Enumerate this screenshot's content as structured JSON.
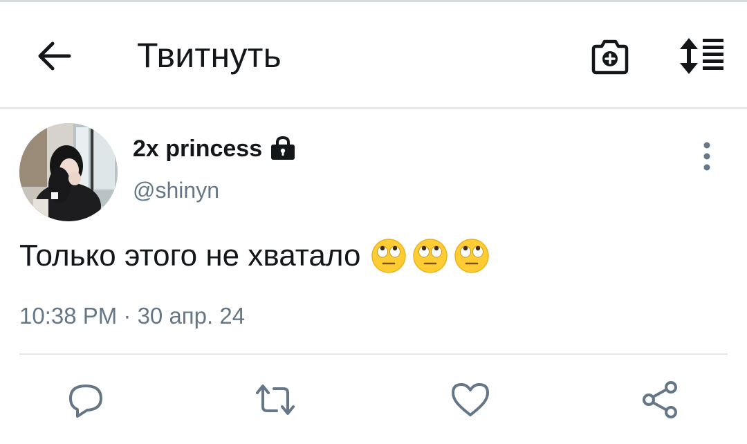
{
  "header": {
    "title": "Твитнуть",
    "back_icon": "arrow-left-icon",
    "camera_icon": "camera-plus-icon",
    "sort_icon": "sort-list-icon"
  },
  "tweet": {
    "author": {
      "display_name": "2x princess",
      "handle": "@shinyn",
      "protected_icon": "lock-icon",
      "avatar": "avatar-photo"
    },
    "text": "Только этого не хватало",
    "emojis": [
      "face-with-rolling-eyes",
      "face-with-rolling-eyes",
      "face-with-rolling-eyes"
    ],
    "timestamp": "10:38 PM · 30 апр. 24"
  },
  "actions": {
    "reply_icon": "reply-icon",
    "retweet_icon": "retweet-icon",
    "like_icon": "heart-icon",
    "share_icon": "share-icon",
    "more_icon": "more-vertical-icon"
  },
  "colors": {
    "text_primary": "#14171a",
    "text_secondary": "#657786",
    "icon_gray": "#657786",
    "divider": "#e6e9ec",
    "emoji_yellow": "#ffcc33"
  }
}
